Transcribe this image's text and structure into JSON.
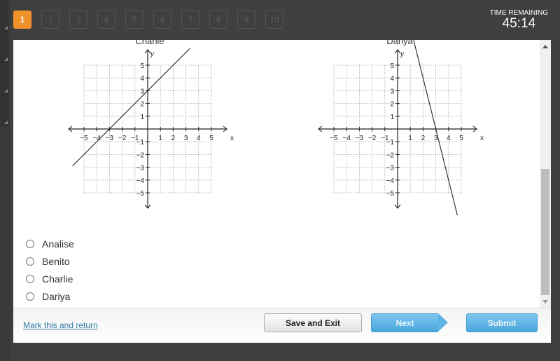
{
  "question_nav": {
    "items": [
      "1",
      "2",
      "3",
      "4",
      "5",
      "6",
      "7",
      "8",
      "9",
      "10"
    ],
    "active": "1"
  },
  "timer": {
    "label": "TIME REMAINING",
    "value": "45:14"
  },
  "chart_data": [
    {
      "type": "line",
      "title": "Charlie",
      "xlabel": "x",
      "ylabel": "y",
      "xlim": [
        -5,
        5
      ],
      "ylim": [
        -5,
        5
      ],
      "x_ticks": [
        -5,
        -4,
        -3,
        -2,
        -1,
        1,
        2,
        3,
        4,
        5
      ],
      "y_ticks": [
        -5,
        -4,
        -3,
        -2,
        -1,
        1,
        2,
        3,
        4,
        5
      ],
      "x_tick_labels": [
        "−5",
        "−4",
        "−3",
        "−2",
        "−1",
        "1",
        "2",
        "3",
        "4",
        "5"
      ],
      "y_tick_labels": [
        "−5",
        "−4",
        "−3",
        "−2",
        "−1",
        "1",
        "2",
        "3",
        "4",
        "5"
      ],
      "grid": true,
      "series": [
        {
          "name": "line",
          "equation": "y = x + 3",
          "slope": 1,
          "intercept": 3,
          "x": [
            -5.9,
            3.3
          ],
          "y": [
            -2.9,
            6.3
          ]
        }
      ]
    },
    {
      "type": "line",
      "title": "Dariya",
      "xlabel": "x",
      "ylabel": "y",
      "xlim": [
        -5,
        5
      ],
      "ylim": [
        -5,
        5
      ],
      "x_ticks": [
        -5,
        -4,
        -3,
        -2,
        -1,
        1,
        2,
        3,
        4,
        5
      ],
      "y_ticks": [
        -5,
        -4,
        -3,
        -2,
        -1,
        1,
        2,
        3,
        4,
        5
      ],
      "x_tick_labels": [
        "−5",
        "−4",
        "−3",
        "−2",
        "−1",
        "1",
        "2",
        "3",
        "4",
        "5"
      ],
      "y_tick_labels": [
        "−5",
        "−4",
        "−3",
        "−2",
        "−1",
        "1",
        "2",
        "3",
        "4",
        "5"
      ],
      "grid": true,
      "series": [
        {
          "name": "line",
          "equation": "y = -4x + 12",
          "slope": -4,
          "intercept": 12,
          "x": [
            0.95,
            5.05
          ],
          "y": [
            8.2,
            -8.2
          ]
        }
      ]
    }
  ],
  "choices": [
    {
      "label": "Analise",
      "selected": false
    },
    {
      "label": "Benito",
      "selected": false
    },
    {
      "label": "Charlie",
      "selected": false
    },
    {
      "label": "Dariya",
      "selected": false
    }
  ],
  "footer": {
    "mark_link": "Mark this and return",
    "save_exit": "Save and Exit",
    "next": "Next",
    "submit": "Submit"
  },
  "colors": {
    "active_question": "#f0922b",
    "primary_button": "#5eb3e5",
    "link": "#2f7ca3"
  }
}
